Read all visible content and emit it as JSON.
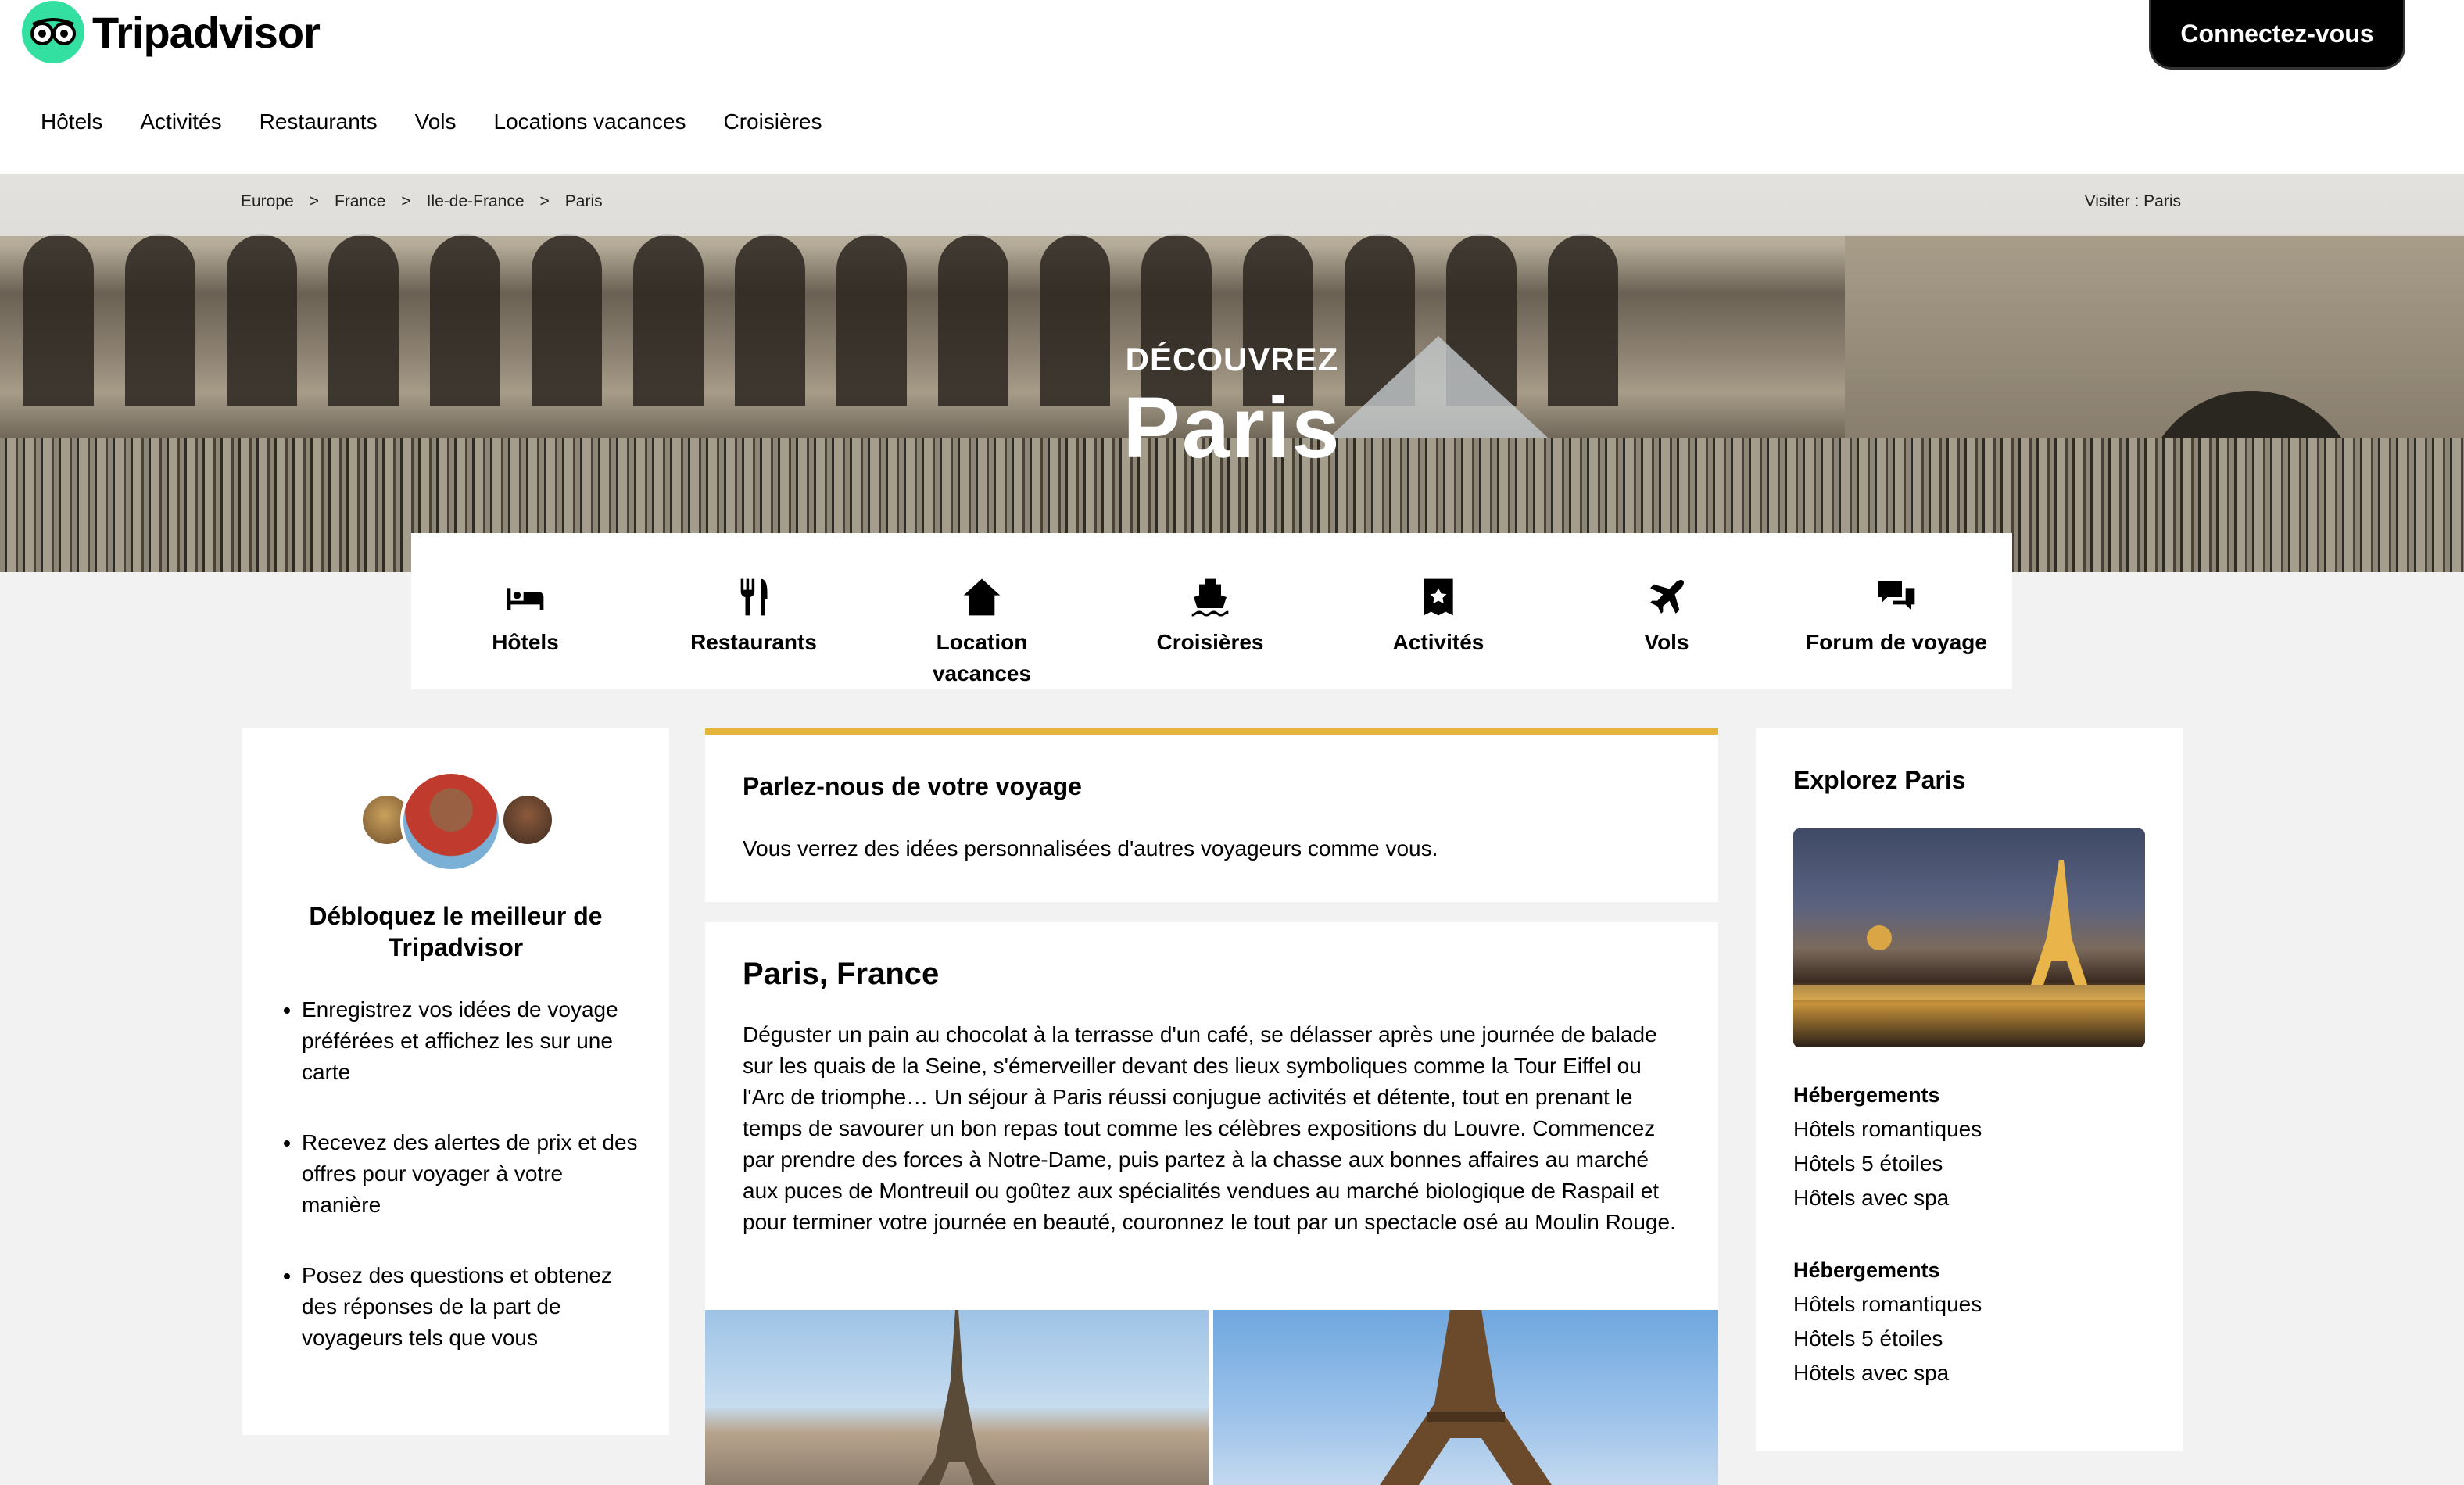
{
  "brand": {
    "name": "Tripadvisor",
    "accent": "#34e0a1"
  },
  "header": {
    "login_label": "Connectez-vous",
    "nav": [
      "Hôtels",
      "Activités",
      "Restaurants",
      "Vols",
      "Locations vacances",
      "Croisières"
    ]
  },
  "breadcrumb": {
    "items": [
      "Europe",
      "France",
      "Ile-de-France",
      "Paris"
    ],
    "separator": ">",
    "visit": "Visiter : Paris"
  },
  "hero": {
    "subtitle": "DÉCOUVREZ",
    "title": "Paris"
  },
  "categories": [
    {
      "label": "Hôtels",
      "icon": "bed-icon"
    },
    {
      "label": "Restaurants",
      "icon": "fork-knife-icon"
    },
    {
      "label": "Location\nvacances",
      "icon": "house-icon"
    },
    {
      "label": "Croisières",
      "icon": "ship-icon"
    },
    {
      "label": "Activités",
      "icon": "ticket-icon"
    },
    {
      "label": "Vols",
      "icon": "plane-icon"
    },
    {
      "label": "Forum de voyage",
      "icon": "chat-bubbles-icon"
    }
  ],
  "promo": {
    "title": "Débloquez le meilleur de Tripadvisor",
    "bullets": [
      "Enregistrez vos idées de voyage préférées et affichez les sur une carte",
      "Recevez des alertes de prix et des offres pour voyager à votre manière",
      "Posez des questions et obtenez des réponses de la part de voyageurs tels que vous"
    ]
  },
  "trip": {
    "title": "Parlez-nous de votre voyage",
    "text": "Vous verrez des idées personnalisées d'autres voyageurs comme vous.",
    "accent": "#e5b43a"
  },
  "about": {
    "title": "Paris, France",
    "text": "Déguster un pain au chocolat à la terrasse d'un café, se délasser après une journée de balade sur les quais de la Seine, s'émerveiller devant des lieux symboliques comme la Tour Eiffel ou l'Arc de triomphe… Un séjour à Paris réussi conjugue activités et détente, tout en prenant le temps de savourer un bon repas tout comme les célèbres expositions du Louvre. Commencez par prendre des forces à Notre-Dame, puis partez à la chasse aux bonnes affaires au marché aux puces de Montreuil ou goûtez aux spécialités vendues au marché biologique de Raspail et pour terminer votre journée en beauté, couronnez le tout par un spectacle osé au Moulin Rouge."
  },
  "explore": {
    "title": "Explorez Paris",
    "groups": [
      {
        "heading": "Hébergements",
        "links": [
          "Hôtels romantiques",
          "Hôtels 5 étoiles",
          "Hôtels avec spa"
        ]
      },
      {
        "heading": "Hébergements",
        "links": [
          "Hôtels romantiques",
          "Hôtels 5 étoiles",
          "Hôtels avec spa"
        ]
      }
    ]
  }
}
